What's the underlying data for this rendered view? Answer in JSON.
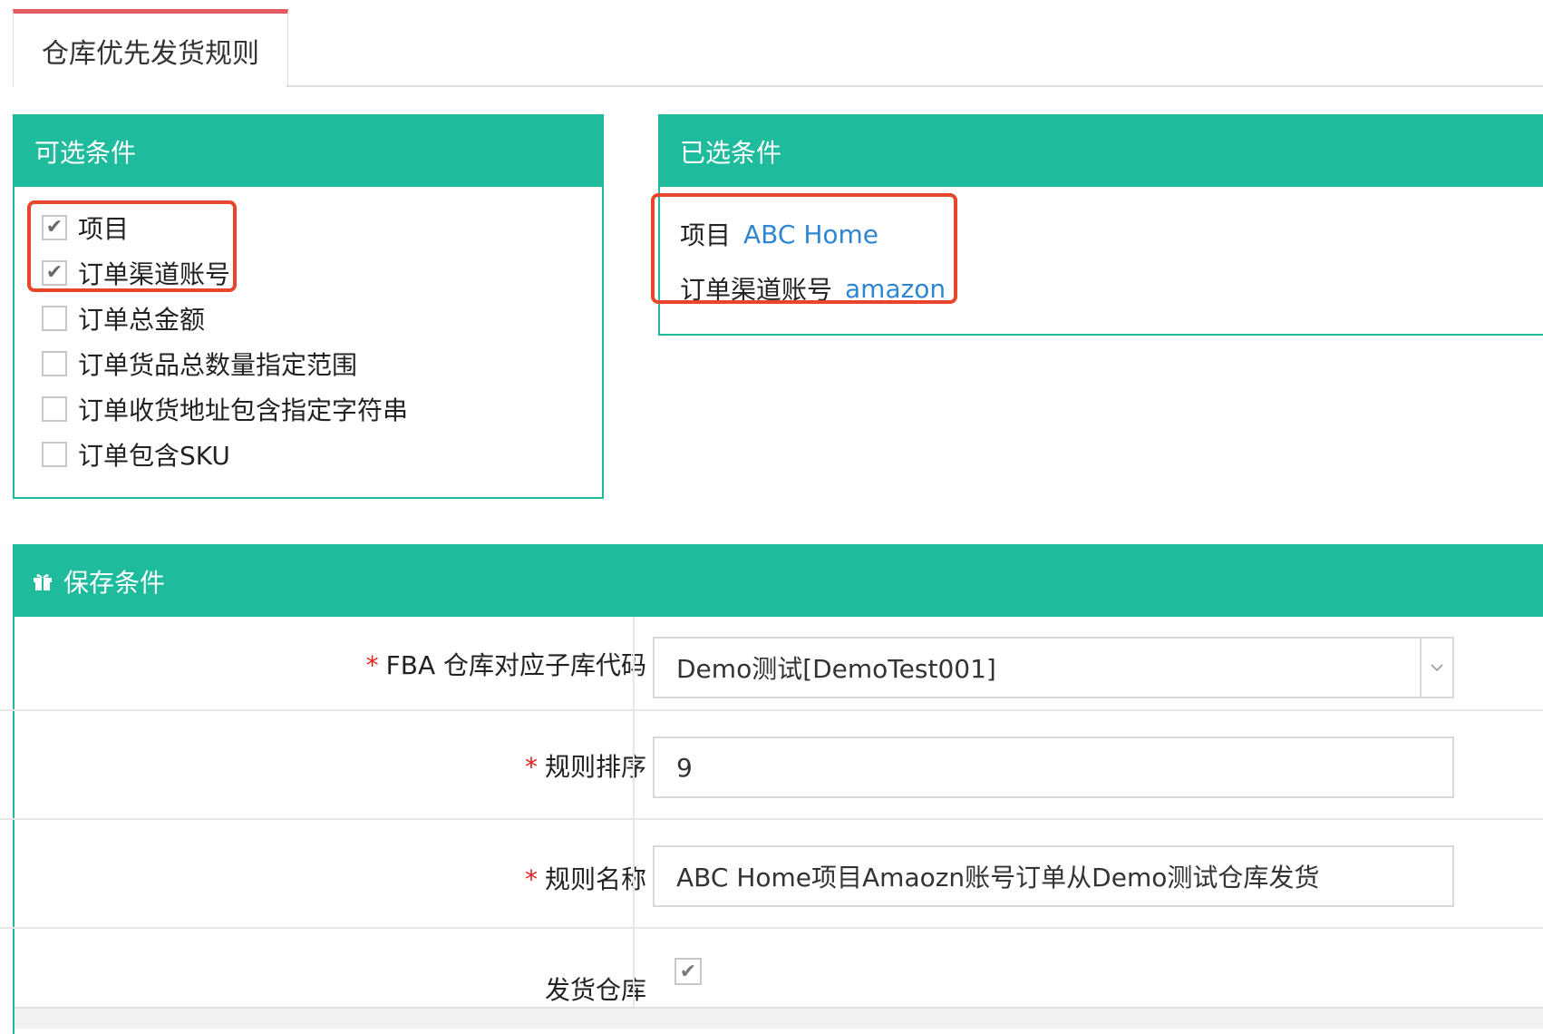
{
  "tabs": {
    "active_label": "仓库优先发货规则"
  },
  "available_conditions": {
    "title": "可选条件",
    "items": [
      {
        "label": "项目",
        "checked": true
      },
      {
        "label": "订单渠道账号",
        "checked": true
      },
      {
        "label": "订单总金额",
        "checked": false
      },
      {
        "label": "订单货品总数量指定范围",
        "checked": false
      },
      {
        "label": "订单收货地址包含指定字符串",
        "checked": false
      },
      {
        "label": "订单包含SKU",
        "checked": false
      }
    ]
  },
  "selected_conditions": {
    "title": "已选条件",
    "rows": [
      {
        "label": "项目",
        "value": "ABC Home"
      },
      {
        "label": "订单渠道账号",
        "value": "amazon"
      }
    ]
  },
  "save": {
    "title": "保存条件",
    "icon": "gift-icon",
    "required_mark": "*",
    "fields": {
      "warehouse_code": {
        "label": "FBA 仓库对应子库代码",
        "value": "Demo测试[DemoTest001]"
      },
      "rule_order": {
        "label": "规则排序",
        "value": "9"
      },
      "rule_name": {
        "label": "规则名称",
        "value": "ABC Home项目Amaozn账号订单从Demo测试仓库发货"
      },
      "ship_warehouse": {
        "label": "发货仓库",
        "checked": true
      }
    }
  },
  "colors": {
    "panel_header": "#1ebc9c",
    "tab_accent": "#e75a62",
    "highlight": "#e8462a",
    "link_value": "#2f86d2",
    "required": "#e02020"
  },
  "icons": {
    "check": "✔",
    "select_arrow": "chevron-down-icon"
  }
}
